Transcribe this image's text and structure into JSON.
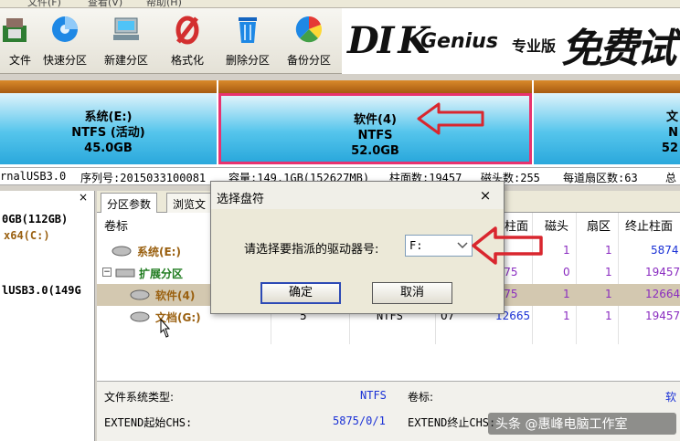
{
  "menubar": {
    "items": [
      "文件(F)",
      "查看(V)",
      "帮助(H)"
    ]
  },
  "toolbar": {
    "buttons": [
      {
        "label": "保存文件",
        "icon": "save-icon"
      },
      {
        "label": "快速分区",
        "icon": "quick-partition-icon"
      },
      {
        "label": "新建分区",
        "icon": "new-partition-icon"
      },
      {
        "label": "格式化",
        "icon": "format-icon"
      },
      {
        "label": "删除分区",
        "icon": "delete-partition-icon"
      },
      {
        "label": "备份分区",
        "icon": "backup-partition-icon"
      }
    ],
    "visible_labels": [
      "文件",
      "快速分区",
      "新建分区",
      "格式化",
      "删除分区",
      "备份分区"
    ]
  },
  "brand": {
    "logo_d": "DI",
    "logo_k": "K",
    "logo_rest": "Genius",
    "edition": "专业版",
    "trial": "免费试用"
  },
  "diskmap": {
    "partitions": [
      {
        "name": "系统(E:)",
        "fs": "NTFS (活动)",
        "size": "45.0GB"
      },
      {
        "name": "软件(4)",
        "fs": "NTFS",
        "size": "52.0GB"
      },
      {
        "name": "文",
        "fs": "N",
        "size": "52"
      }
    ]
  },
  "diskinfo": {
    "model": "rnalUSB3.0",
    "serial": "序列号:2015033100081",
    "capacity": "容量:149.1GB(152627MB)",
    "cylinders": "柱面数:19457",
    "heads": "磁头数:255",
    "sectors": "每道扇区数:63",
    "total": "总"
  },
  "tree": {
    "close": "×",
    "lines": [
      "0GB(112GB)",
      "x64(C:)",
      "lUSB3.0(149G"
    ]
  },
  "tabs": [
    "分区参数",
    "浏览文"
  ],
  "table": {
    "headers": {
      "volume": "卷标",
      "cyl_end_partial": "柱面",
      "head": "磁头",
      "sector": "扇区",
      "end_cyl": "终止柱面"
    },
    "rows": [
      {
        "name": "系统(E:)",
        "start_cyl": "",
        "head": "1",
        "sector": "1",
        "end": "5874"
      },
      {
        "name": "扩展分区",
        "start_cyl": "5875",
        "head": "0",
        "sector": "1",
        "end": "19457"
      },
      {
        "name": "软件(4)",
        "start_cyl": "5875",
        "head": "1",
        "sector": "1",
        "end": "12664"
      },
      {
        "name": "文档(G:)",
        "id": "5",
        "fs": "NTFS",
        "type": "07",
        "start_cyl": "12665",
        "head": "1",
        "sector": "1",
        "end": "19457"
      }
    ]
  },
  "details": {
    "fs_type_label": "文件系统类型:",
    "fs_type_value": "NTFS",
    "volume_label": "卷标:",
    "volume_value": "软",
    "ext_start_label": "EXTEND起始CHS:",
    "ext_start_value": "5875/0/1",
    "ext_end_label": "EXTEND终止CHS:"
  },
  "dialog": {
    "title": "选择盘符",
    "close": "×",
    "prompt": "请选择要指派的驱动器号:",
    "selected_drive": "F:",
    "ok": "确定",
    "cancel": "取消"
  },
  "watermark": "头条 @惠峰电脑工作室",
  "colors": {
    "partition_cap": "#c1701a",
    "partition_body": "#3ab4e4",
    "selection": "#e8336f",
    "arrow": "#d9262e",
    "value_blue": "#1a31d6",
    "value_purple": "#8a2cc0"
  }
}
